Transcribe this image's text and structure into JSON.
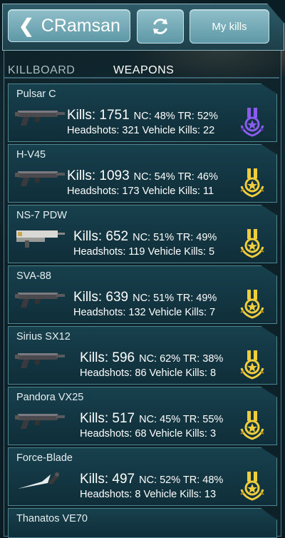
{
  "header": {
    "back_label": "CRamsan",
    "my_kills_label": "My kills"
  },
  "tabs": [
    {
      "label": "KILLBOARD",
      "active": false
    },
    {
      "label": "WEAPONS",
      "active": true
    }
  ],
  "weapons": [
    {
      "name": "Pulsar C",
      "kills": "Kills: 1751",
      "ratio": "NC: 48% TR: 52%",
      "stats": "Headshots: 321  Vehicle Kills: 22",
      "medal": "purple-medal-icon"
    },
    {
      "name": "H-V45",
      "kills": "Kills: 1093",
      "ratio": "NC: 54% TR: 46%",
      "stats": "Headshots: 173  Vehicle Kills: 11",
      "medal": "gold-medal-icon"
    },
    {
      "name": "NS-7 PDW",
      "kills": "Kills: 652",
      "ratio": "NC: 51% TR: 49%",
      "stats": "Headshots: 119  Vehicle Kills: 5",
      "medal": "gold-medal-icon"
    },
    {
      "name": "SVA-88",
      "kills": "Kills: 639",
      "ratio": "NC: 51% TR: 49%",
      "stats": "Headshots: 132  Vehicle Kills: 7",
      "medal": "gold-medal-icon"
    },
    {
      "name": "Sirius SX12",
      "kills": "Kills: 596",
      "ratio": "NC: 62% TR: 38%",
      "stats": "Headshots: 86  Vehicle Kills: 8",
      "medal": "gold-medal-icon"
    },
    {
      "name": "Pandora VX25",
      "kills": "Kills: 517",
      "ratio": "NC: 45% TR: 55%",
      "stats": "Headshots: 68  Vehicle Kills: 3",
      "medal": "gold-medal-icon"
    },
    {
      "name": "Force-Blade",
      "kills": "Kills: 497",
      "ratio": "NC: 52% TR: 48%",
      "stats": "Headshots: 8  Vehicle Kills: 13",
      "medal": "gold-medal-icon"
    }
  ],
  "partial_weapon": {
    "name": "Thanatos VE70"
  },
  "colors": {
    "purple_medal": "#7a4fd6",
    "gold_medal": "#e8c53a",
    "frame": "#8fb3bd"
  }
}
